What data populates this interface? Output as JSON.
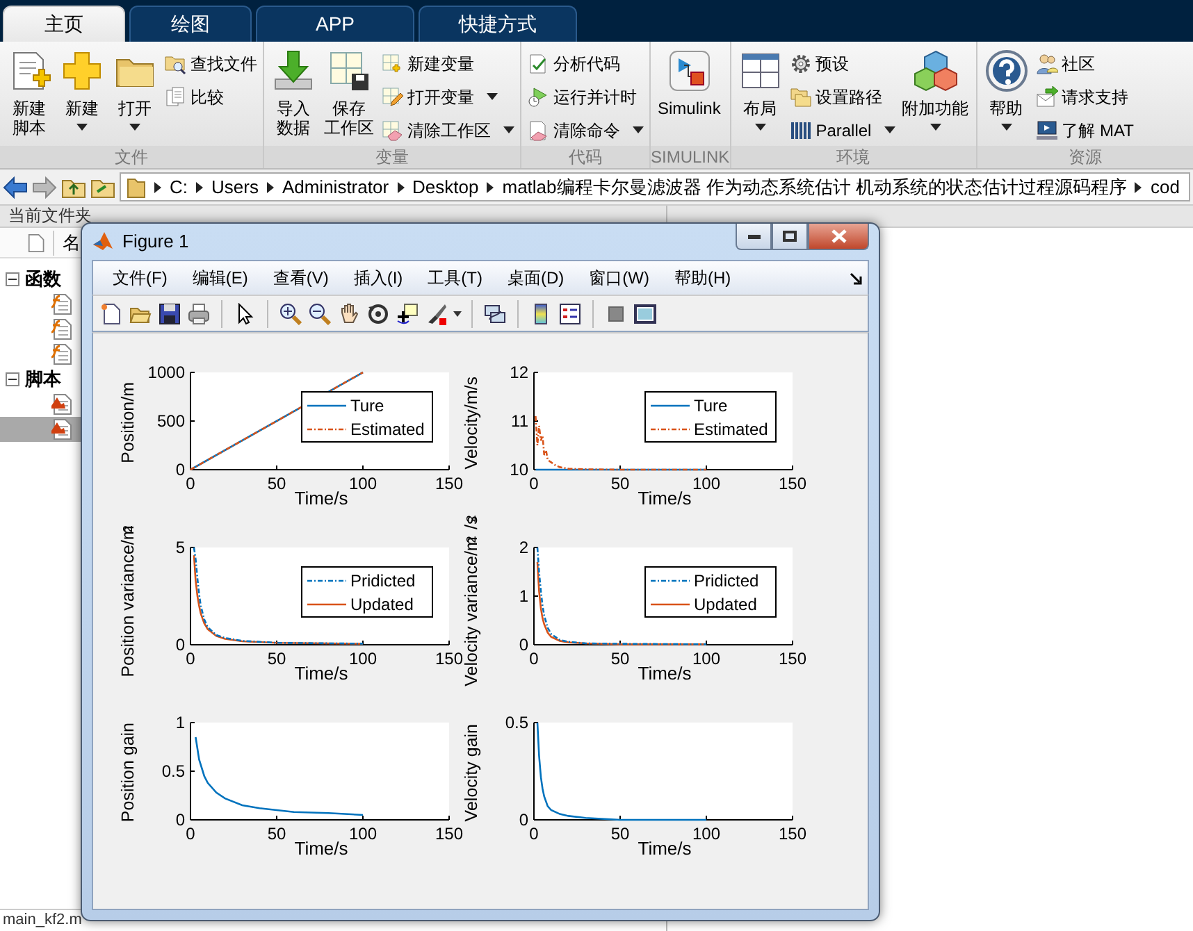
{
  "tabs": [
    {
      "label": "主页",
      "selected": true
    },
    {
      "label": "绘图",
      "selected": false
    },
    {
      "label": "APP",
      "selected": false
    },
    {
      "label": "快捷方式",
      "selected": false
    }
  ],
  "ribbon": [
    {
      "title": "文件",
      "items": [
        {
          "kind": "large",
          "label": [
            "新建",
            "脚本"
          ],
          "dropdown": false
        },
        {
          "kind": "large",
          "label": [
            "新建"
          ],
          "dropdown": true
        },
        {
          "kind": "large",
          "label": [
            "打开"
          ],
          "dropdown": true
        },
        {
          "kind": "stack",
          "items": [
            {
              "label": "查找文件",
              "dropdown": false
            },
            {
              "label": "比较",
              "dropdown": false
            }
          ]
        }
      ]
    },
    {
      "title": "变量",
      "items": [
        {
          "kind": "large",
          "label": [
            "导入",
            "数据"
          ],
          "dropdown": false
        },
        {
          "kind": "large",
          "label": [
            "保存",
            "工作区"
          ],
          "dropdown": false
        },
        {
          "kind": "stack",
          "items": [
            {
              "label": "新建变量",
              "dropdown": false
            },
            {
              "label": "打开变量",
              "dropdown": true
            },
            {
              "label": "清除工作区",
              "dropdown": true
            }
          ]
        }
      ]
    },
    {
      "title": "代码",
      "items": [
        {
          "kind": "stack",
          "items": [
            {
              "label": "分析代码",
              "dropdown": false
            },
            {
              "label": "运行并计时",
              "dropdown": false
            },
            {
              "label": "清除命令",
              "dropdown": true
            }
          ]
        }
      ]
    },
    {
      "title": "SIMULINK",
      "items": [
        {
          "kind": "large",
          "label": [
            "Simulink"
          ],
          "dropdown": false
        }
      ]
    },
    {
      "title": "环境",
      "items": [
        {
          "kind": "large",
          "label": [
            "布局"
          ],
          "dropdown": true
        },
        {
          "kind": "stack",
          "items": [
            {
              "label": "预设",
              "dropdown": false
            },
            {
              "label": "设置路径",
              "dropdown": false
            },
            {
              "label": "Parallel",
              "dropdown": true
            }
          ]
        },
        {
          "kind": "large",
          "label": [
            "附加功能"
          ],
          "dropdown": true
        }
      ]
    },
    {
      "title": "资源",
      "items": [
        {
          "kind": "large",
          "label": [
            "帮助"
          ],
          "dropdown": true
        },
        {
          "kind": "stack",
          "items": [
            {
              "label": "社区",
              "dropdown": false
            },
            {
              "label": "请求支持",
              "dropdown": false
            },
            {
              "label": "了解 MAT",
              "dropdown": false
            }
          ]
        }
      ]
    }
  ],
  "address": {
    "crumbs": [
      "C:",
      "Users",
      "Administrator",
      "Desktop",
      "matlab编程卡尔曼滤波器 作为动态系统估计 机动系统的状态估计过程源码程序",
      "cod"
    ]
  },
  "file_browser": {
    "title": "当前文件夹",
    "column_1": "名",
    "groups": [
      {
        "label": "函数",
        "expanded": true,
        "files": [
          {
            "kind": "function",
            "selected": false
          },
          {
            "kind": "function",
            "selected": false
          },
          {
            "kind": "function",
            "selected": false
          }
        ]
      },
      {
        "label": "脚本",
        "expanded": true,
        "files": [
          {
            "kind": "script",
            "selected": false
          },
          {
            "kind": "script",
            "selected": true
          }
        ]
      }
    ],
    "status": "main_kf2.m"
  },
  "figure": {
    "title": "Figure 1",
    "menu": [
      "文件(F)",
      "编辑(E)",
      "查看(V)",
      "插入(I)",
      "工具(T)",
      "桌面(D)",
      "窗口(W)",
      "帮助(H)"
    ],
    "axes": [
      {
        "chart_data": {
          "type": "line",
          "xlabel": "Time/s",
          "ylabel": "Position/m",
          "xlim": [
            0,
            150
          ],
          "ylim": [
            0,
            1000
          ],
          "xticks": [
            0,
            50,
            100,
            150
          ],
          "yticks": [
            0,
            500,
            1000
          ],
          "legend": true,
          "x": [
            0,
            100
          ],
          "series": [
            {
              "name": "Ture",
              "color": "#0072bd",
              "line_style": "solid",
              "values": [
                0,
                1000
              ]
            },
            {
              "name": "Estimated",
              "color": "#d95319",
              "line_style": "dashdot",
              "values": [
                0,
                1000
              ]
            }
          ]
        }
      },
      {
        "chart_data": {
          "type": "line",
          "xlabel": "Time/s",
          "ylabel": "Velocity/m/s",
          "xlim": [
            0,
            150
          ],
          "ylim": [
            10,
            12
          ],
          "xticks": [
            0,
            50,
            100,
            150
          ],
          "yticks": [
            10,
            11,
            12
          ],
          "legend": true,
          "x": [
            1,
            2,
            3,
            4,
            5,
            6,
            7,
            8,
            10,
            12,
            15,
            20,
            30,
            50,
            100
          ],
          "series": [
            {
              "name": "Ture",
              "color": "#0072bd",
              "line_style": "solid",
              "values": [
                10,
                10,
                10,
                10,
                10,
                10,
                10,
                10,
                10,
                10,
                10,
                10,
                10,
                10,
                10
              ]
            },
            {
              "name": "Estimated",
              "color": "#d95319",
              "line_style": "dashdot",
              "values": [
                11.1,
                10.5,
                10.9,
                10.6,
                10.7,
                10.3,
                10.4,
                10.2,
                10.15,
                10.1,
                10.05,
                10.02,
                10.01,
                10,
                10
              ]
            }
          ]
        }
      },
      {
        "chart_data": {
          "type": "line",
          "xlabel": "Time/s",
          "ylabel": "Position variance/m$^{2}$",
          "xlim": [
            0,
            150
          ],
          "ylim": [
            0,
            5
          ],
          "xticks": [
            0,
            50,
            100,
            150
          ],
          "yticks": [
            0,
            5
          ],
          "legend": true,
          "x": [
            2,
            3,
            4,
            5,
            6,
            8,
            10,
            15,
            20,
            30,
            50,
            100
          ],
          "series": [
            {
              "name": "Pridicted",
              "color": "#0072bd",
              "line_style": "dashdot",
              "values": [
                5,
                4.4,
                3.4,
                2.6,
                2,
                1.3,
                0.9,
                0.5,
                0.35,
                0.2,
                0.1,
                0.06
              ]
            },
            {
              "name": "Updated",
              "color": "#d95319",
              "line_style": "solid",
              "values": [
                4.6,
                3.3,
                2.5,
                2,
                1.6,
                1.1,
                0.8,
                0.45,
                0.3,
                0.18,
                0.1,
                0.05
              ]
            }
          ]
        }
      },
      {
        "chart_data": {
          "type": "line",
          "xlabel": "Time/s",
          "ylabel": "Velocity variance/m$^{2}$/s$^{2}$",
          "xlim": [
            0,
            150
          ],
          "ylim": [
            0,
            2
          ],
          "xticks": [
            0,
            50,
            100,
            150
          ],
          "yticks": [
            0,
            1,
            2
          ],
          "legend": true,
          "x": [
            2,
            3,
            4,
            5,
            6,
            8,
            10,
            15,
            20,
            30,
            50,
            100
          ],
          "series": [
            {
              "name": "Pridicted",
              "color": "#0072bd",
              "line_style": "dashdot",
              "values": [
                2,
                1.5,
                1.1,
                0.8,
                0.6,
                0.35,
                0.22,
                0.1,
                0.06,
                0.03,
                0.02,
                0.01
              ]
            },
            {
              "name": "Updated",
              "color": "#d95319",
              "line_style": "solid",
              "values": [
                1.7,
                1.1,
                0.75,
                0.55,
                0.42,
                0.25,
                0.16,
                0.08,
                0.05,
                0.03,
                0.01,
                0.01
              ]
            }
          ]
        }
      },
      {
        "chart_data": {
          "type": "line",
          "xlabel": "Time/s",
          "ylabel": "Position gain",
          "xlim": [
            0,
            150
          ],
          "ylim": [
            0,
            1
          ],
          "xticks": [
            0,
            50,
            100,
            150
          ],
          "yticks": [
            0,
            0.5,
            1
          ],
          "x": [
            3,
            5,
            8,
            10,
            15,
            20,
            30,
            40,
            50,
            60,
            80,
            100
          ],
          "series": [
            {
              "color": "#0072bd",
              "line_style": "solid",
              "values": [
                0.85,
                0.62,
                0.45,
                0.38,
                0.28,
                0.22,
                0.15,
                0.12,
                0.1,
                0.08,
                0.07,
                0.05
              ]
            }
          ]
        }
      },
      {
        "chart_data": {
          "type": "line",
          "xlabel": "Time/s",
          "ylabel": "Velocity gain",
          "xlim": [
            0,
            150
          ],
          "ylim": [
            0,
            0.5
          ],
          "xticks": [
            0,
            50,
            100,
            150
          ],
          "yticks": [
            0,
            0.5
          ],
          "x": [
            2,
            3,
            4,
            5,
            6,
            8,
            10,
            15,
            20,
            30,
            50,
            100
          ],
          "series": [
            {
              "color": "#0072bd",
              "line_style": "solid",
              "values": [
                0.5,
                0.33,
                0.22,
                0.16,
                0.12,
                0.07,
                0.05,
                0.03,
                0.02,
                0.01,
                0,
                0
              ]
            }
          ]
        }
      }
    ]
  }
}
